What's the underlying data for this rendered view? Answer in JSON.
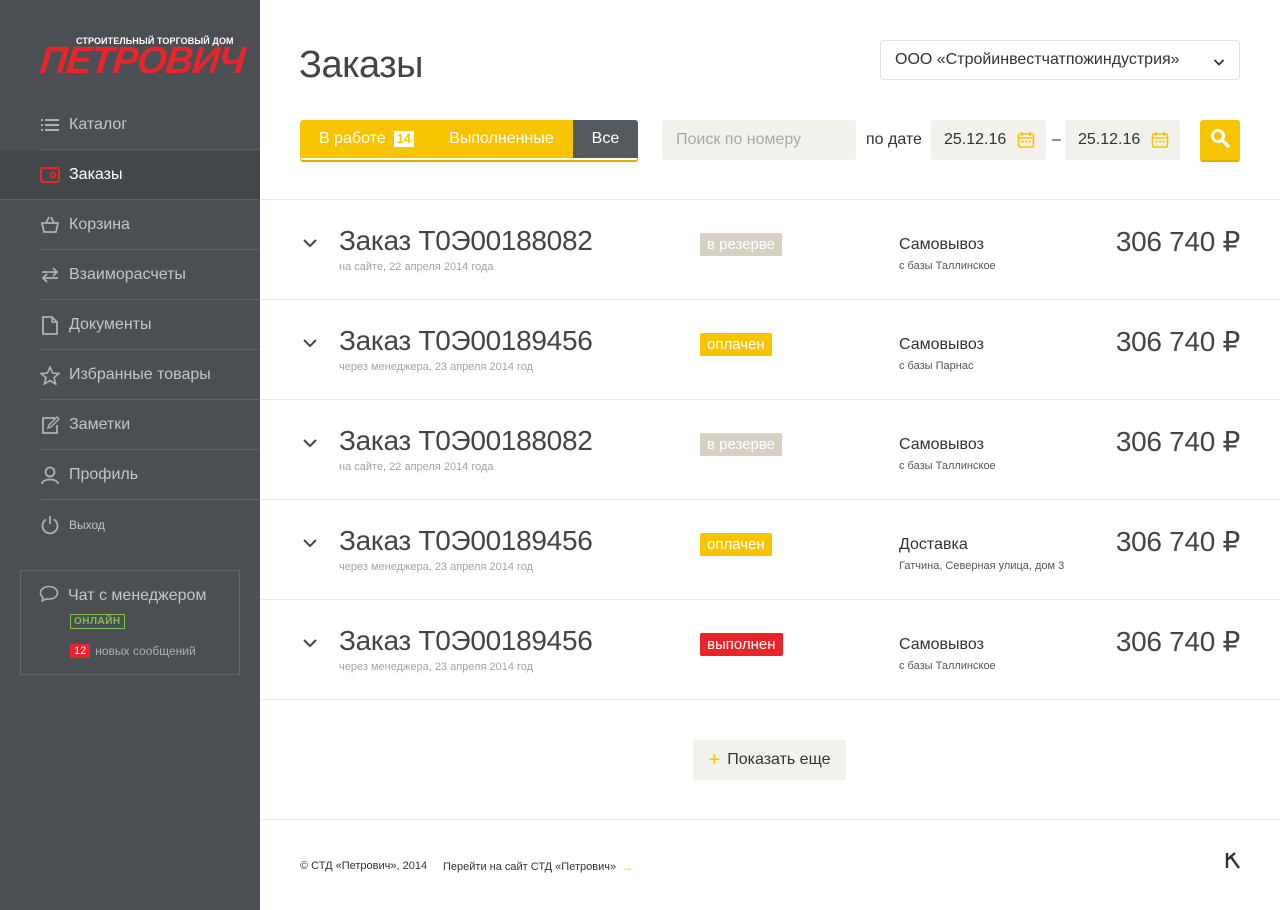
{
  "logo": {
    "subtitle": "СТРОИТЕЛЬНЫЙ ТОРГОВЫЙ ДОМ",
    "name": "ПЕТРОВИЧ"
  },
  "nav": [
    {
      "label": "Каталог",
      "icon": "list-icon"
    },
    {
      "label": "Заказы",
      "icon": "wallet-icon",
      "active": true
    },
    {
      "label": "Корзина",
      "icon": "basket-icon"
    },
    {
      "label": "Взаиморасчеты",
      "icon": "arrows-icon"
    },
    {
      "label": "Документы",
      "icon": "document-icon"
    },
    {
      "label": "Избранные товары",
      "icon": "star-icon"
    },
    {
      "label": "Заметки",
      "icon": "note-icon"
    },
    {
      "label": "Профиль",
      "icon": "user-icon"
    }
  ],
  "logout": {
    "label": "Выход"
  },
  "chat": {
    "title": "Чат с менеджером",
    "status": "ОНЛАЙН",
    "count": "12",
    "messages_label": "новых сообщений"
  },
  "header": {
    "title": "Заказы",
    "company": "ООО «Стройинвестчатпожиндустрия»"
  },
  "filters": {
    "tab_in_work": "В работе",
    "tab_in_work_count": "14",
    "tab_done": "Выполненные",
    "tab_all": "Все",
    "search_placeholder": "Поиск по номеру",
    "by_date": "по дате",
    "date_from": "25.12.16",
    "date_dash": "–",
    "date_to": "25.12.16"
  },
  "orders": [
    {
      "number": "Заказ Т0Э00188082",
      "source": "на сайте, 22 апреля 2014 года",
      "status": "в резерве",
      "status_kind": "reserve",
      "delivery": "Самовывоз",
      "address": "с базы Таллинское",
      "price": "306 740 ₽"
    },
    {
      "number": "Заказ Т0Э00189456",
      "source": "через менеджера, 23 апреля 2014 год",
      "status": "оплачен",
      "status_kind": "paid",
      "delivery": "Самовывоз",
      "address": "с базы Парнас",
      "price": "306 740 ₽"
    },
    {
      "number": "Заказ Т0Э00188082",
      "source": "на сайте, 22 апреля 2014 года",
      "status": "в резерве",
      "status_kind": "reserve",
      "delivery": "Самовывоз",
      "address": "с базы Таллинское",
      "price": "306 740 ₽"
    },
    {
      "number": "Заказ Т0Э00189456",
      "source": "через менеджера, 23 апреля 2014 год",
      "status": "оплачен",
      "status_kind": "paid",
      "delivery": "Доставка",
      "address": "Гатчина, Северная улица, дом 3",
      "price": "306 740 ₽"
    },
    {
      "number": "Заказ Т0Э00189456",
      "source": "через менеджера, 23 апреля 2014 год",
      "status": "выполнен",
      "status_kind": "done",
      "delivery": "Самовывоз",
      "address": "с базы Таллинское",
      "price": "306 740 ₽"
    }
  ],
  "show_more": "Показать еще",
  "footer": {
    "copyright": "© СТД «Петрович», 2014",
    "site_link": "Перейти на сайт СТД «Петрович»",
    "arrow": "→"
  },
  "colors": {
    "accent": "#f6c400",
    "brand_red": "#e8252b",
    "sidebar": "#4b4f53"
  }
}
